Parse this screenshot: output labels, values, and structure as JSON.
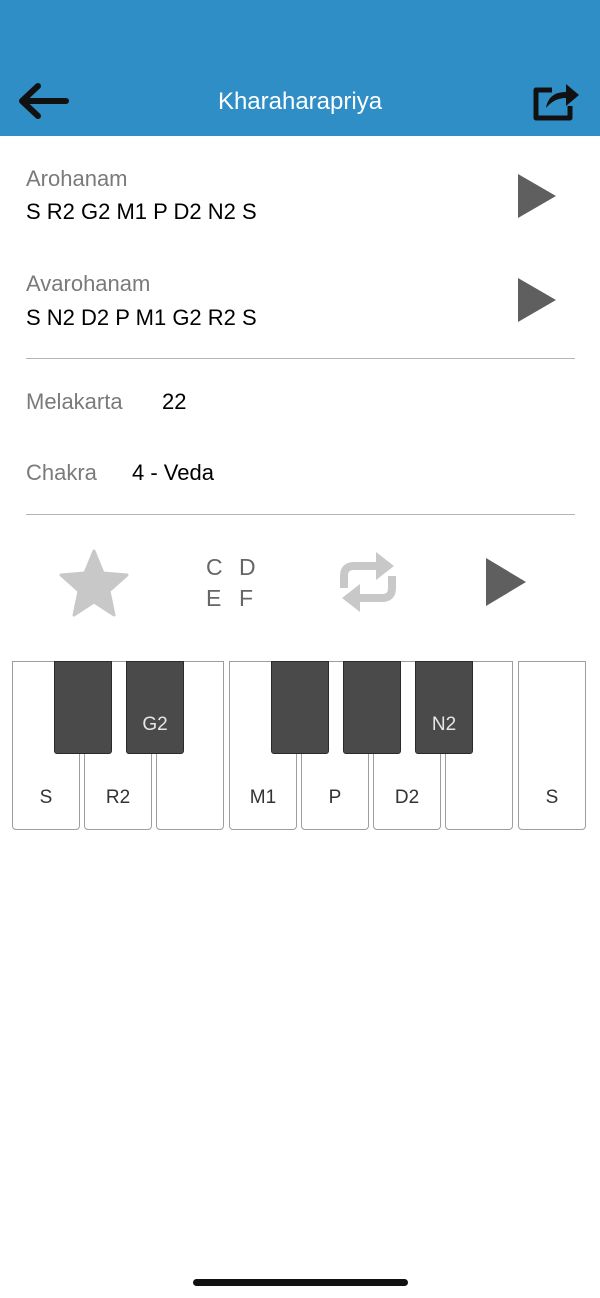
{
  "header": {
    "title": "Kharaharapriya",
    "back_icon": "arrow-left-icon",
    "share_icon": "share-icon",
    "background": "#2f8ec6"
  },
  "arohanam": {
    "label": "Arohanam",
    "notes": "S R2 G2 M1 P D2 N2 S",
    "play_icon": "play-icon"
  },
  "avarohanam": {
    "label": "Avarohanam",
    "notes": "S N2 D2 P M1 G2 R2 S",
    "play_icon": "play-icon"
  },
  "details": {
    "melakarta_label": "Melakarta",
    "melakarta_value": "22",
    "chakra_label": "Chakra",
    "chakra_value": "4 - Veda"
  },
  "controls": {
    "favorite_icon": "star-icon",
    "notes_grid": [
      "C",
      "D",
      "E",
      "F"
    ],
    "repeat_icon": "repeat-icon",
    "play_icon": "play-icon"
  },
  "keyboard": {
    "white_keys": [
      "S",
      "R2",
      "",
      "M1",
      "P",
      "D2",
      "",
      "S"
    ],
    "black_keys": [
      "",
      "G2",
      "",
      "",
      "N2"
    ]
  }
}
